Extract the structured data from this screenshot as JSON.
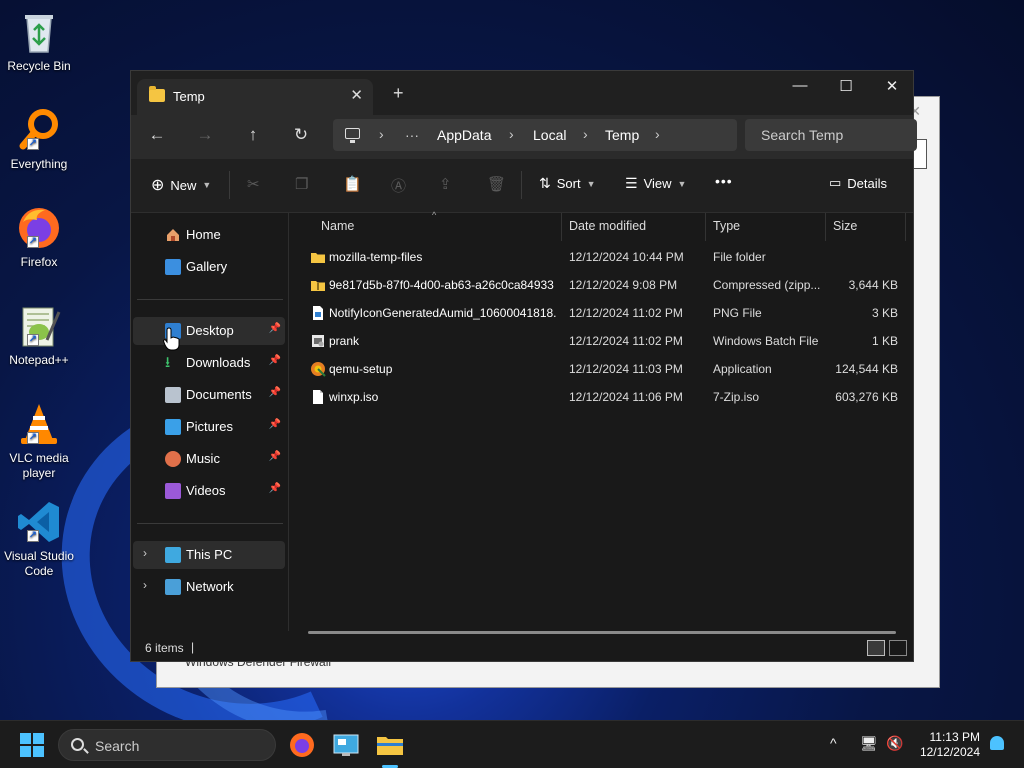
{
  "desktop": {
    "icons": [
      {
        "label": "Recycle Bin"
      },
      {
        "label": "Everything"
      },
      {
        "label": "Firefox"
      },
      {
        "label": "Notepad++"
      },
      {
        "label": "VLC media player"
      },
      {
        "label": "Visual Studio Code"
      }
    ],
    "background_window_footer": "Windows Defender Firewall"
  },
  "explorer": {
    "tab_title": "Temp",
    "breadcrumbs": [
      "AppData",
      "Local",
      "Temp"
    ],
    "search_placeholder": "Search Temp",
    "toolbar": {
      "new_label": "New",
      "sort_label": "Sort",
      "view_label": "View",
      "more_label": "•••",
      "details_label": "Details"
    },
    "sidebar": {
      "items": [
        {
          "label": "Home"
        },
        {
          "label": "Gallery"
        },
        {
          "label": "Desktop"
        },
        {
          "label": "Downloads"
        },
        {
          "label": "Documents"
        },
        {
          "label": "Pictures"
        },
        {
          "label": "Music"
        },
        {
          "label": "Videos"
        },
        {
          "label": "This PC"
        },
        {
          "label": "Network"
        }
      ]
    },
    "columns": {
      "name": "Name",
      "date": "Date modified",
      "type": "Type",
      "size": "Size"
    },
    "files": [
      {
        "name": "mozilla-temp-files",
        "date": "12/12/2024 10:44 PM",
        "type": "File folder",
        "size": ""
      },
      {
        "name": "9e817d5b-87f0-4d00-ab63-a26c0ca84933",
        "date": "12/12/2024 9:08 PM",
        "type": "Compressed (zipp...",
        "size": "3,644 KB"
      },
      {
        "name": "NotifyIconGeneratedAumid_10600041818...",
        "date": "12/12/2024 11:02 PM",
        "type": "PNG File",
        "size": "3 KB"
      },
      {
        "name": "prank",
        "date": "12/12/2024 11:02 PM",
        "type": "Windows Batch File",
        "size": "1 KB"
      },
      {
        "name": "qemu-setup",
        "date": "12/12/2024 11:03 PM",
        "type": "Application",
        "size": "124,544 KB"
      },
      {
        "name": "winxp.iso",
        "date": "12/12/2024 11:06 PM",
        "type": "7-Zip.iso",
        "size": "603,276 KB"
      }
    ],
    "status": {
      "item_count": "6 items",
      "caret": "|"
    }
  },
  "taskbar": {
    "search_label": "Search",
    "time": "11:13 PM",
    "date": "12/12/2024"
  },
  "colors": {
    "accent": "#4cc2ff",
    "folder": "#f5c542",
    "explorer_bg": "#191919"
  }
}
